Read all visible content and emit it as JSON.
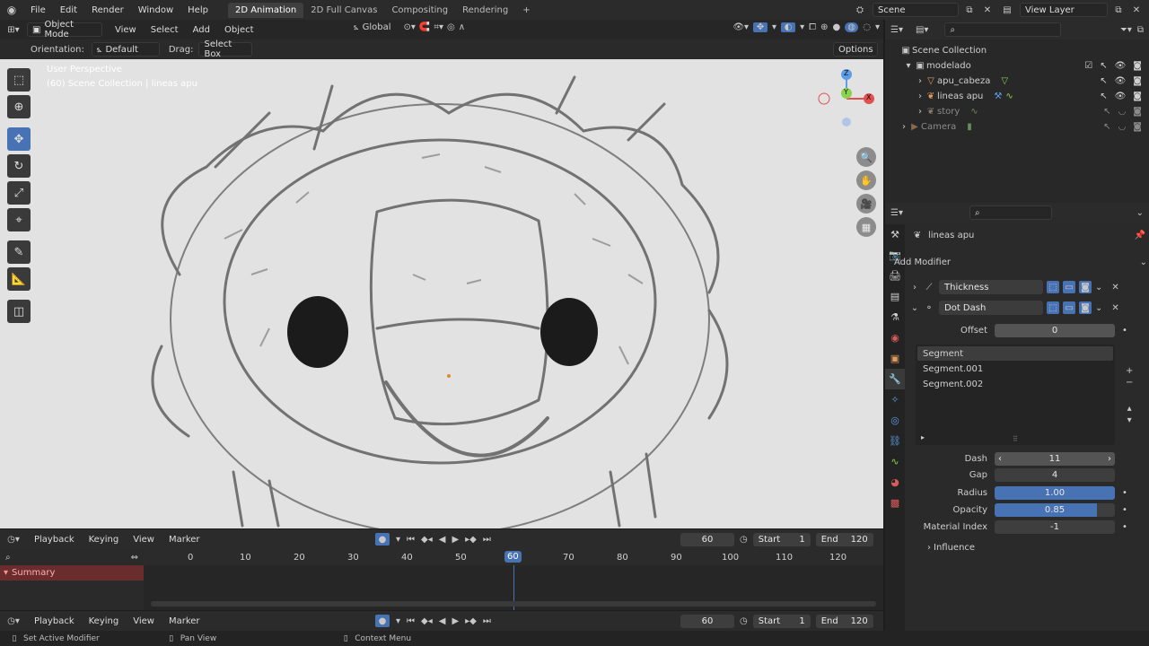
{
  "topbar": {
    "menus": [
      "File",
      "Edit",
      "Render",
      "Window",
      "Help"
    ],
    "workspaces": [
      "2D Animation",
      "2D Full Canvas",
      "Compositing",
      "Rendering"
    ],
    "add_workspace": "+",
    "scene": "Scene",
    "view_layer": "View Layer"
  },
  "viewport": {
    "mode": "Object Mode",
    "menus": [
      "View",
      "Select",
      "Add",
      "Object"
    ],
    "orientation_global": "Global",
    "tool": {
      "orientation_label": "Orientation:",
      "orientation_value": "Default",
      "drag_label": "Drag:",
      "drag_value": "Select Box",
      "options": "Options"
    },
    "overlay_title": "User Perspective",
    "overlay_sub": "(60) Scene Collection | lineas apu",
    "gizmo": {
      "z": "Z",
      "y": "Y",
      "x": "X"
    }
  },
  "outliner": {
    "root": "Scene Collection",
    "items": [
      {
        "label": "modelado",
        "indent": 1
      },
      {
        "label": "apu_cabeza",
        "indent": 2
      },
      {
        "label": "lineas apu",
        "indent": 2
      },
      {
        "label": "story",
        "indent": 2
      },
      {
        "label": "Camera",
        "indent": 0
      }
    ]
  },
  "properties": {
    "object_name": "lineas apu",
    "add_modifier": "Add Modifier",
    "modifiers": [
      "Thickness",
      "Dot Dash"
    ],
    "offset": {
      "label": "Offset",
      "value": "0"
    },
    "segments": [
      "Segment",
      "Segment.001",
      "Segment.002"
    ],
    "dash": {
      "label": "Dash",
      "value": "11"
    },
    "gap": {
      "label": "Gap",
      "value": "4"
    },
    "radius": {
      "label": "Radius",
      "value": "1.00",
      "fill": 1.0
    },
    "opacity": {
      "label": "Opacity",
      "value": "0.85",
      "fill": 0.85
    },
    "material_index": {
      "label": "Material Index",
      "value": "-1"
    },
    "influence": "Influence"
  },
  "timeline": {
    "menus": [
      "Playback",
      "Keying",
      "View",
      "Marker"
    ],
    "current_frame": "60",
    "start_label": "Start",
    "start": "1",
    "end_label": "End",
    "end": "120",
    "ticks": [
      "0",
      "10",
      "20",
      "30",
      "40",
      "50",
      "60",
      "70",
      "80",
      "90",
      "100",
      "110",
      "120"
    ],
    "summary": "Summary"
  },
  "status": {
    "items": [
      "Set Active Modifier",
      "Pan View",
      "Context Menu"
    ]
  },
  "colors": {
    "accent": "#4772b3",
    "x_axis": "#e14f4f",
    "y_axis": "#8bd14d",
    "z_axis": "#5d9ce6",
    "bg": "#1d1d1d"
  }
}
